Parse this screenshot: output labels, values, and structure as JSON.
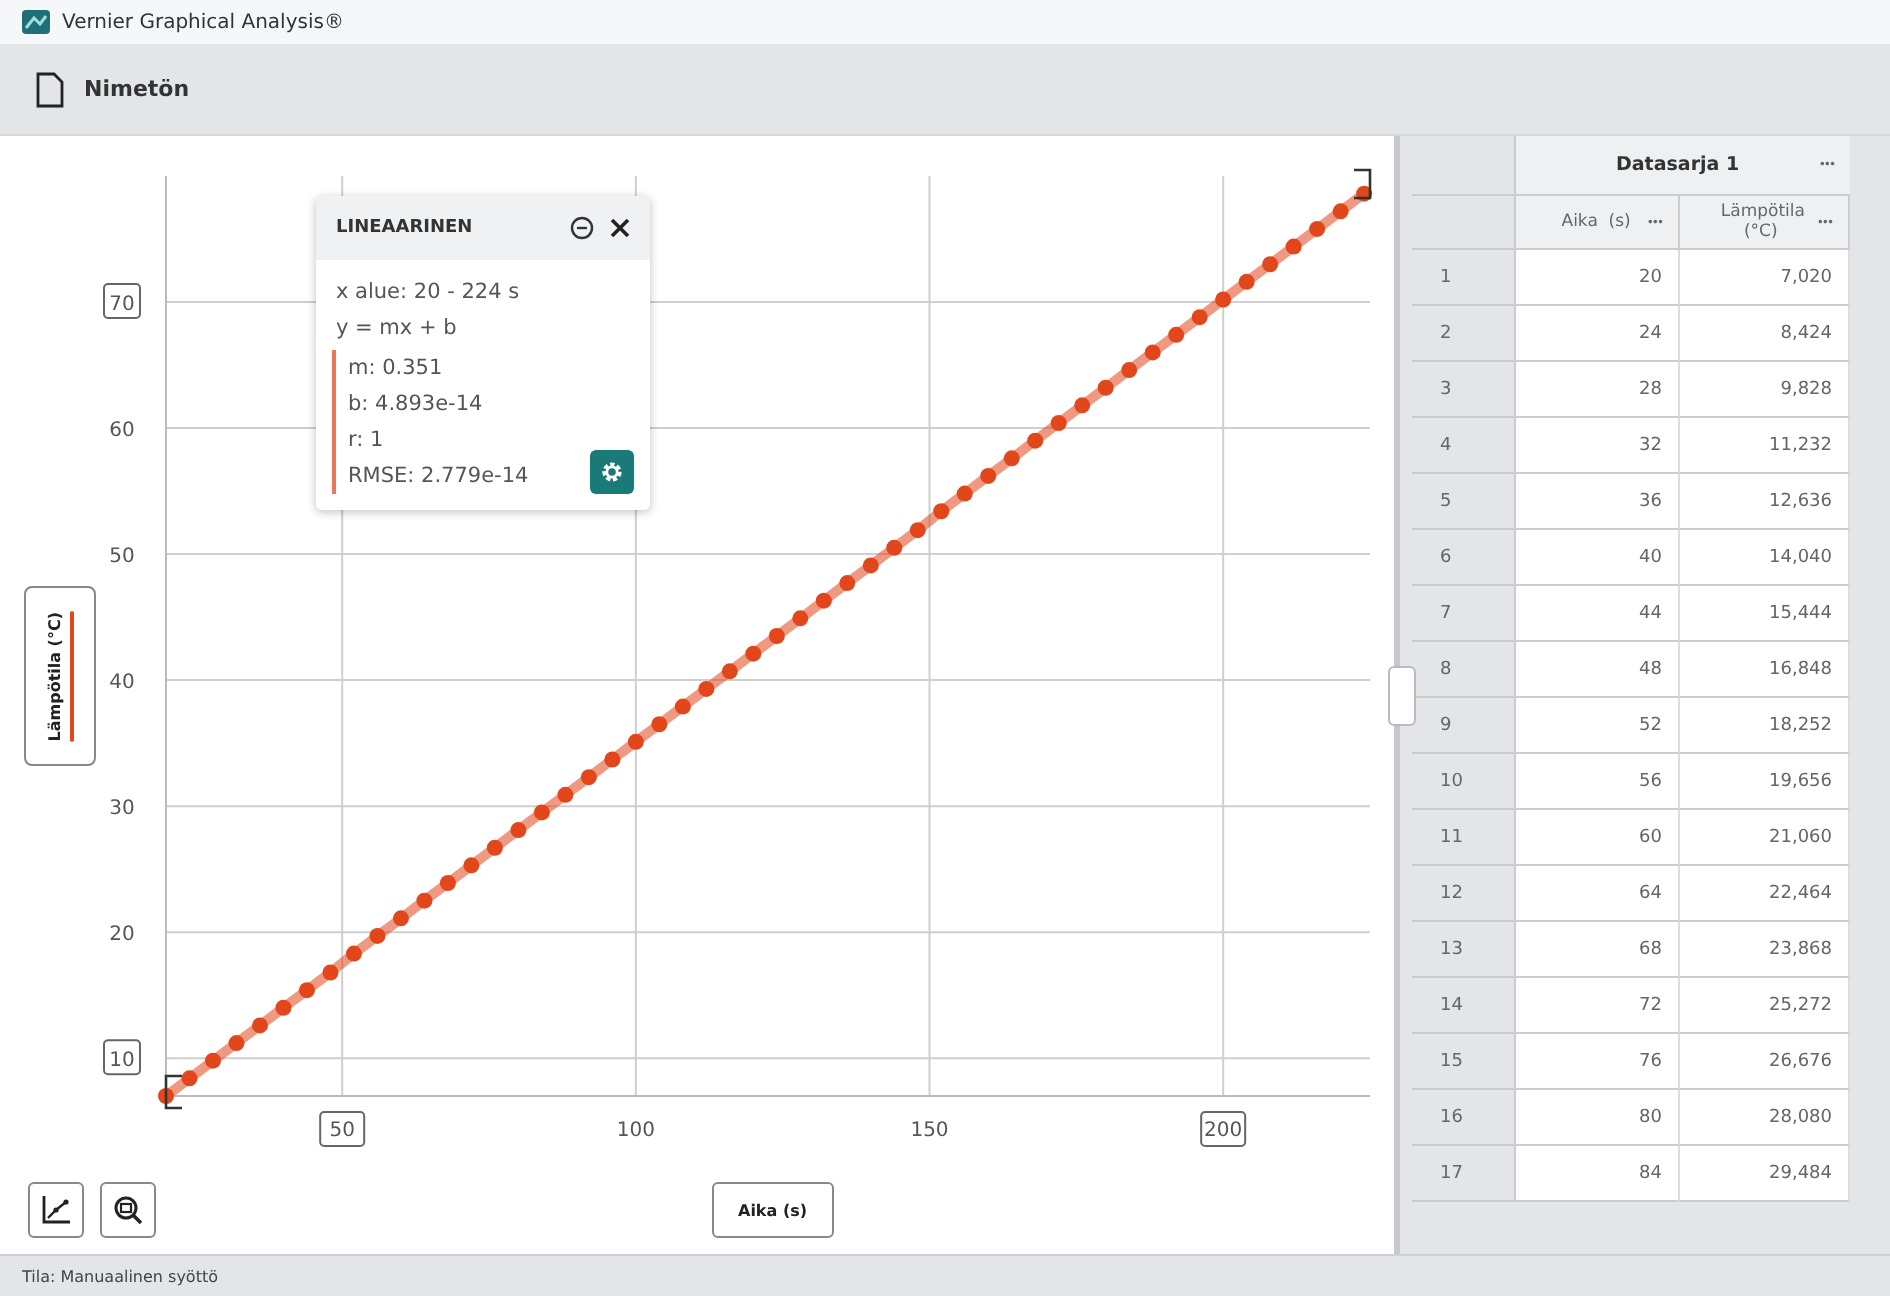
{
  "window": {
    "title": "Vernier Graphical Analysis®"
  },
  "toolbar": {
    "file_name": "Nimetön"
  },
  "graph": {
    "chart_data": {
      "type": "line",
      "xlabel": "Aika (s)",
      "xlim": [
        20,
        225
      ],
      "ylim": [
        7,
        80
      ],
      "grid": true,
      "xticks": [
        50,
        100,
        150,
        200
      ],
      "yticks": [
        10,
        20,
        30,
        40,
        50,
        60,
        70
      ],
      "x": [
        20,
        24,
        28,
        32,
        36,
        40,
        44,
        48,
        52,
        56,
        60,
        64,
        68,
        72,
        76,
        80,
        84,
        88,
        92,
        96,
        100,
        104,
        108,
        112,
        116,
        120,
        124,
        128,
        132,
        136,
        140,
        144,
        148,
        152,
        156,
        160,
        164,
        168,
        172,
        176,
        180,
        184,
        188,
        192,
        196,
        200,
        204,
        208,
        212,
        216,
        220,
        224
      ],
      "series": [
        {
          "name": "Lämpötila (°C)",
          "color": "#e2461b",
          "marker": true,
          "values": [
            7.0,
            8.4,
            9.8,
            11.2,
            12.6,
            14.0,
            15.4,
            16.8,
            18.3,
            19.7,
            21.1,
            22.5,
            23.9,
            25.3,
            26.7,
            28.1,
            29.5,
            30.9,
            32.3,
            33.7,
            35.1,
            36.5,
            37.9,
            39.3,
            40.7,
            42.1,
            43.5,
            44.9,
            46.3,
            47.7,
            49.1,
            50.5,
            51.9,
            53.4,
            54.8,
            56.2,
            57.6,
            59.0,
            60.4,
            61.8,
            63.2,
            64.6,
            66.0,
            67.4,
            68.8,
            70.2,
            71.6,
            73.0,
            74.4,
            75.8,
            77.2,
            78.6
          ]
        }
      ]
    },
    "fit_panel": {
      "title": "LINEAARINEN",
      "lines": [
        "x alue: 20 - 224 s",
        "y = mx + b"
      ],
      "params": [
        "m: 0.351",
        "b: 4.893e-14",
        "r: 1",
        "RMSE: 2.779e-14"
      ]
    }
  },
  "table": {
    "dataset": "Datasarja 1",
    "dataset_menu": "•••",
    "columns": [
      {
        "label": "Aika  (s)",
        "menu": "•••"
      },
      {
        "label": "Lämpötila (°C)",
        "menu": "•••"
      }
    ],
    "row_numbers": [
      "1",
      "2",
      "3",
      "4",
      "5",
      "6",
      "7",
      "8",
      "9",
      "10",
      "11",
      "12",
      "13",
      "14",
      "15",
      "16",
      "17"
    ],
    "rows": [
      [
        "20",
        "7,020"
      ],
      [
        "24",
        "8,424"
      ],
      [
        "28",
        "9,828"
      ],
      [
        "32",
        "11,232"
      ],
      [
        "36",
        "12,636"
      ],
      [
        "40",
        "14,040"
      ],
      [
        "44",
        "15,444"
      ],
      [
        "48",
        "16,848"
      ],
      [
        "52",
        "18,252"
      ],
      [
        "56",
        "19,656"
      ],
      [
        "60",
        "21,060"
      ],
      [
        "64",
        "22,464"
      ],
      [
        "68",
        "23,868"
      ],
      [
        "72",
        "25,272"
      ],
      [
        "76",
        "26,676"
      ],
      [
        "80",
        "28,080"
      ],
      [
        "84",
        "29,484"
      ]
    ]
  },
  "status_bar": "Tila: Manuaalinen syöttö"
}
